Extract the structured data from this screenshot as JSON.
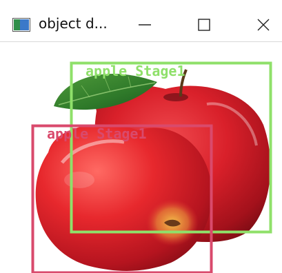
{
  "window": {
    "title": "object d...",
    "controls": {
      "minimize": "minimize",
      "maximize": "maximize",
      "close": "close"
    }
  },
  "detections": [
    {
      "label": "apple Stage1",
      "color": "#8fe06a"
    },
    {
      "label": "apple Stage1",
      "color": "#d94a6c"
    }
  ]
}
